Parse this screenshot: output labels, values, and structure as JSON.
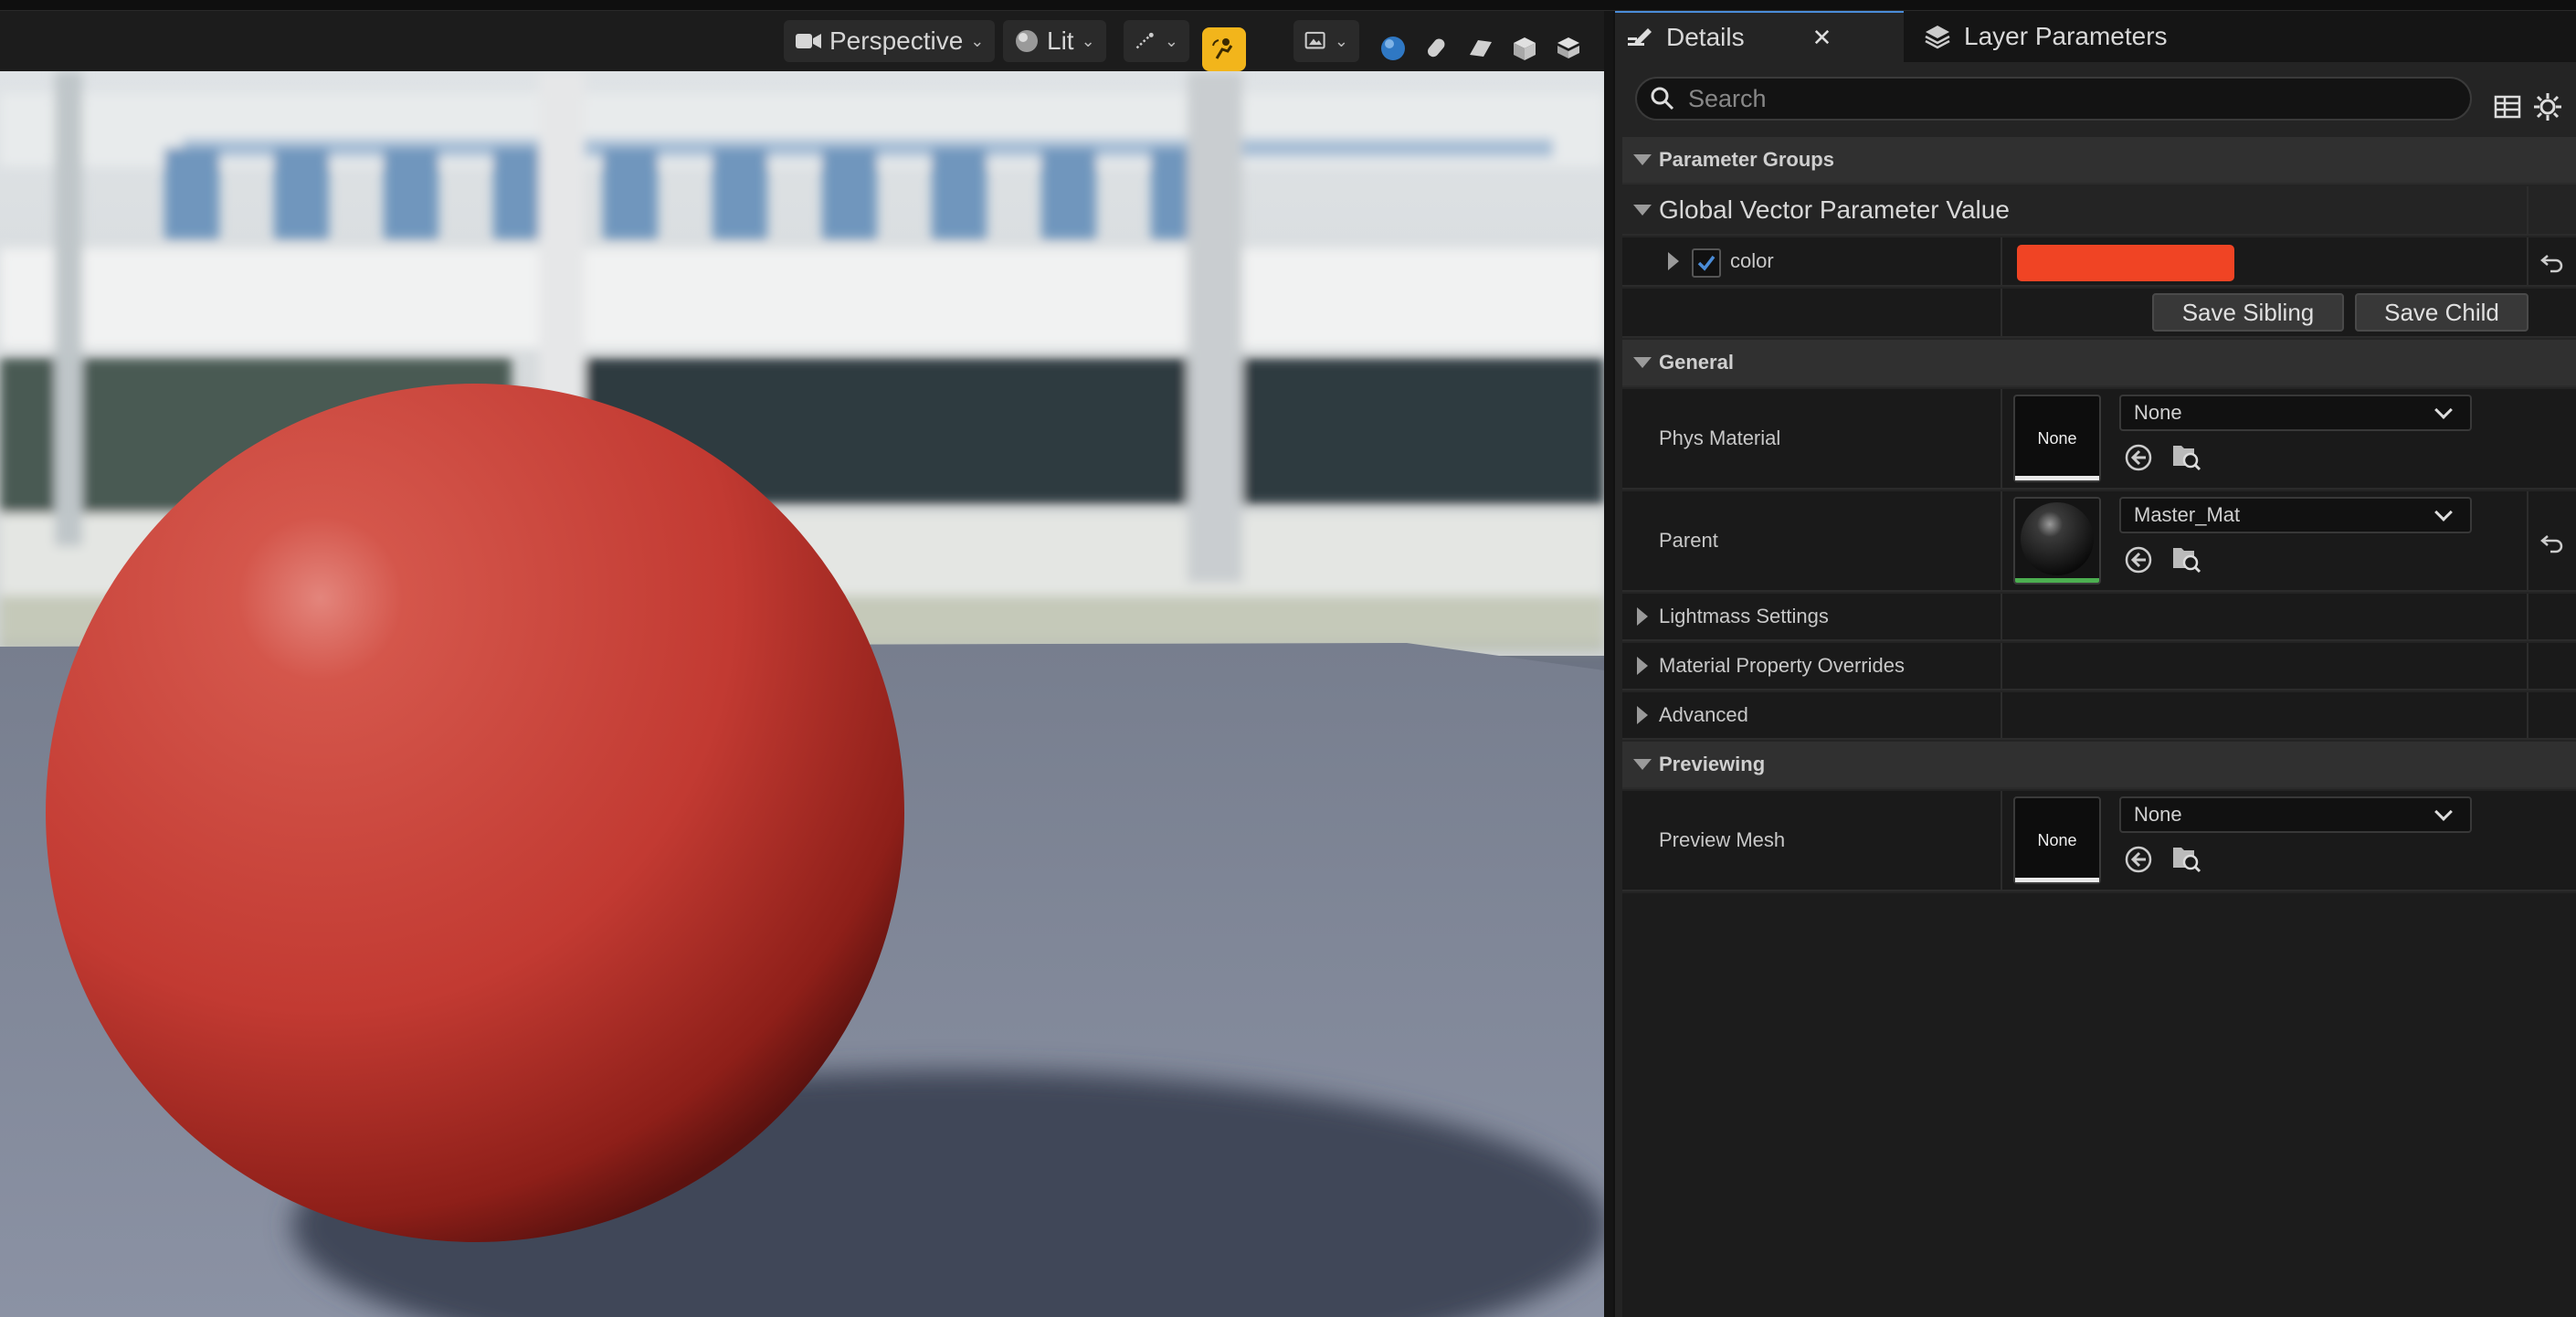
{
  "toolbar": {
    "perspective_label": "Perspective",
    "lit_label": "Lit"
  },
  "tabs": {
    "details": "Details",
    "layer_parameters": "Layer Parameters"
  },
  "search": {
    "placeholder": "Search"
  },
  "sections": {
    "parameter_groups": "Parameter Groups",
    "global_vector": "Global Vector Parameter Value",
    "general": "General",
    "lightmass": "Lightmass Settings",
    "material_overrides": "Material Property Overrides",
    "advanced": "Advanced",
    "previewing": "Previewing"
  },
  "color_param": {
    "name": "color",
    "enabled": true,
    "value_hex": "#f04424"
  },
  "buttons": {
    "save_sibling": "Save Sibling",
    "save_child": "Save Child"
  },
  "properties": {
    "phys_material": {
      "label": "Phys Material",
      "thumb": "None",
      "value": "None"
    },
    "parent": {
      "label": "Parent",
      "value": "Master_Mat"
    },
    "preview_mesh": {
      "label": "Preview Mesh",
      "thumb": "None",
      "value": "None"
    }
  },
  "colors": {
    "accent_yellow": "#f2b51b",
    "accent_blue": "#4a8cd8",
    "parent_thumb_bar": "#4caf50",
    "sphere_red": "#c8403a"
  }
}
